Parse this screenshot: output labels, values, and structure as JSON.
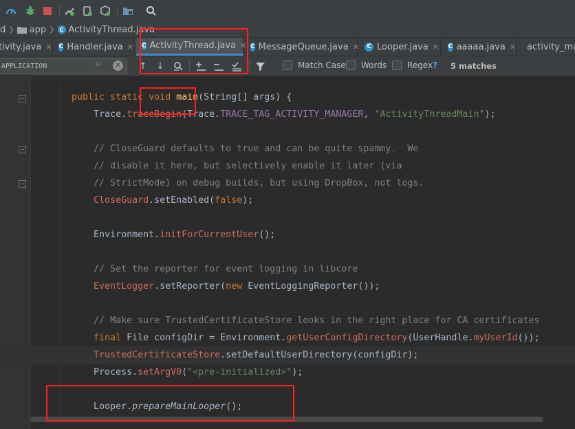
{
  "toolbar": {
    "icons": [
      "gauge-icon",
      "debug-bug-icon",
      "stop-icon",
      "attach-debugger-icon",
      "avd-manager-icon",
      "sdk-manager-icon",
      "project-structure-icon",
      "search-icon"
    ]
  },
  "breadcrumb": {
    "items": [
      "d",
      "app",
      "ActivityThread.java"
    ]
  },
  "tabs": [
    {
      "label": "tivity.java",
      "icon": ""
    },
    {
      "label": "Handler.java",
      "icon": "C"
    },
    {
      "label": "ActivityThread.java",
      "icon": "C"
    },
    {
      "label": "MessageQueue.java",
      "icon": "C"
    },
    {
      "label": "Looper.java",
      "icon": "C"
    },
    {
      "label": "aaaaa.java",
      "icon": "C"
    },
    {
      "label": "activity_ma",
      "icon": ""
    }
  ],
  "findbar": {
    "search_value": "APPLICATION",
    "match_case": "Match Case",
    "words": "Words",
    "regex": "Regex",
    "help": "?",
    "matches": "5 matches"
  },
  "code": {
    "lines": [
      [
        {
          "t": "    "
        },
        {
          "t": "public static void ",
          "c": "kw"
        },
        {
          "t": "main",
          "c": "fn"
        },
        {
          "t": "(String[] args) {"
        }
      ],
      [
        {
          "t": "        Trace."
        },
        {
          "t": "traceBegin",
          "c": "rd"
        },
        {
          "t": "(Trace."
        },
        {
          "t": "TRACE_TAG_ACTIVITY_MANAGER",
          "c": "pu"
        },
        {
          "t": ", "
        },
        {
          "t": "\"ActivityThreadMain\"",
          "c": "st"
        },
        {
          "t": ");"
        }
      ],
      [
        {
          "t": ""
        }
      ],
      [
        {
          "t": "        "
        },
        {
          "t": "// CloseGuard defaults to true and can be quite spammy.  We",
          "c": "cm"
        }
      ],
      [
        {
          "t": "        "
        },
        {
          "t": "// disable it here, but selectively enable it later (via",
          "c": "cm"
        }
      ],
      [
        {
          "t": "        "
        },
        {
          "t": "// StrictMode) on debug builds, but using DropBox, not logs.",
          "c": "cm"
        }
      ],
      [
        {
          "t": "        "
        },
        {
          "t": "CloseGuard",
          "c": "rd"
        },
        {
          "t": ".setEnabled("
        },
        {
          "t": "false",
          "c": "kw"
        },
        {
          "t": ");"
        }
      ],
      [
        {
          "t": ""
        }
      ],
      [
        {
          "t": "        Environment."
        },
        {
          "t": "initForCurrentUser",
          "c": "rd"
        },
        {
          "t": "();"
        }
      ],
      [
        {
          "t": ""
        }
      ],
      [
        {
          "t": "        "
        },
        {
          "t": "// Set the reporter for event logging in libcore",
          "c": "cm"
        }
      ],
      [
        {
          "t": "        "
        },
        {
          "t": "EventLogger",
          "c": "rd"
        },
        {
          "t": ".setReporter("
        },
        {
          "t": "new ",
          "c": "kw"
        },
        {
          "t": "EventLoggingReporter());"
        }
      ],
      [
        {
          "t": ""
        }
      ],
      [
        {
          "t": "        "
        },
        {
          "t": "// Make sure TrustedCertificateStore looks in the right place for CA certificates",
          "c": "cm"
        }
      ],
      [
        {
          "t": "        "
        },
        {
          "t": "final ",
          "c": "kw"
        },
        {
          "t": "File configDir = Environment."
        },
        {
          "t": "getUserConfigDirectory",
          "c": "rd"
        },
        {
          "t": "(UserHandle."
        },
        {
          "t": "myUserId",
          "c": "rd"
        },
        {
          "t": "());"
        }
      ],
      [
        {
          "t": "        "
        },
        {
          "t": "TrustedCertificateStore",
          "c": "rd"
        },
        {
          "t": ".setDefaultUserDirectory(configDir);"
        }
      ],
      [
        {
          "t": "        Process."
        },
        {
          "t": "setArgV0",
          "c": "rd"
        },
        {
          "t": "("
        },
        {
          "t": "\"<pre-initialized>\"",
          "c": "st"
        },
        {
          "t": ");"
        }
      ],
      [
        {
          "t": ""
        }
      ],
      [
        {
          "t": "        Looper."
        },
        {
          "t": "prepareMainLooper",
          "c": "it"
        },
        {
          "t": "();"
        }
      ]
    ]
  },
  "colors": {
    "background": "#2b2b2b",
    "keyword": "#cc7832",
    "function": "#ffc66d",
    "string": "#6a8759",
    "comment": "#808080",
    "annotation_box": "#ff1f1f"
  }
}
